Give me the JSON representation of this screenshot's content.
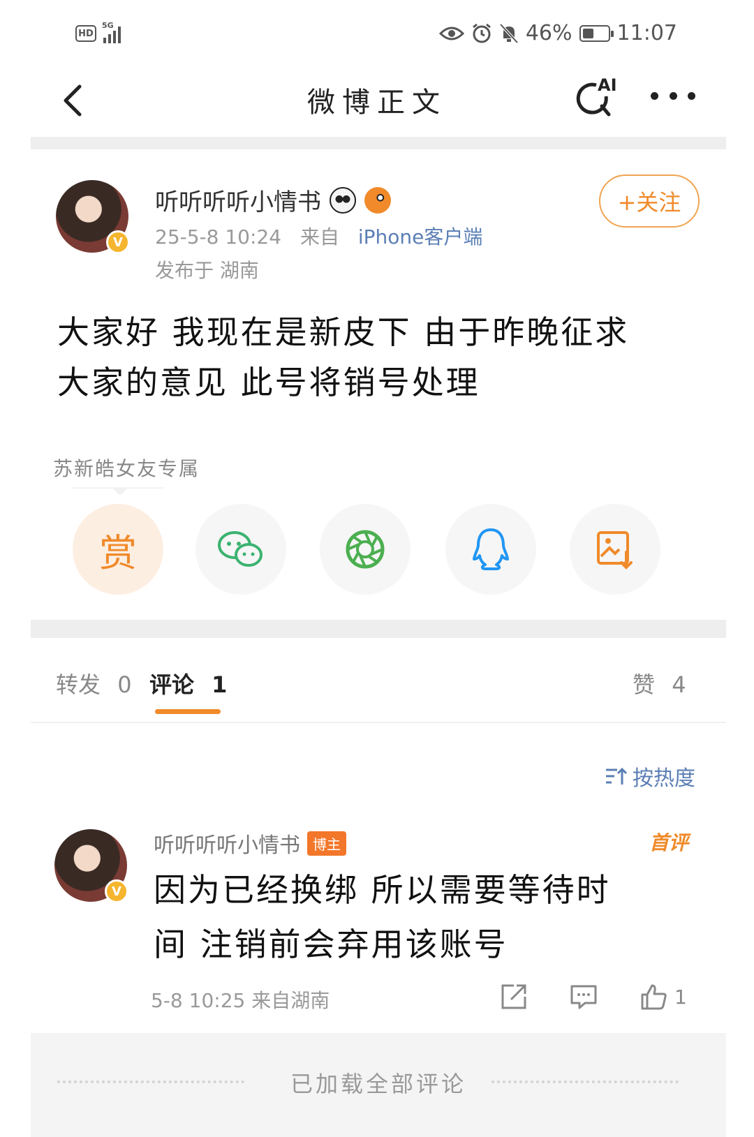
{
  "status_bar": {
    "hd": "HD",
    "network": "5G",
    "battery": "46%",
    "battery_level": 0.46,
    "time": "11:07"
  },
  "nav": {
    "title": "微博正文",
    "ai_label": "AI"
  },
  "post": {
    "author": "听听听听小情书",
    "follow_label": "+关注",
    "datetime": "25-5-8 10:24",
    "from_prefix": "来自",
    "source": "iPhone客户端",
    "location": "发布于 湖南",
    "content_line1": "大家好 我现在是新皮下 由于昨晚征求",
    "content_line2": "大家的意见 此号将销号处理",
    "tag": "苏新皓女友专属"
  },
  "share": {
    "reward_label": "赏"
  },
  "tabs": [
    {
      "label": "转发",
      "count": "0"
    },
    {
      "label": "评论",
      "count": "1"
    },
    {
      "label": "赞",
      "count": "4"
    }
  ],
  "sort_label": "按热度",
  "comment": {
    "author": "听听听听小情书",
    "host_badge": "博主",
    "first_tag": "首评",
    "text_line1": "因为已经换绑 所以需要等待时",
    "text_line2": "间 注销前会弃用该账号",
    "meta": "5-8 10:25 来自湖南",
    "like_count": "1"
  },
  "footer_text": "已加载全部评论",
  "colors": {
    "accent": "#f08a2a",
    "link": "#5b7fb5",
    "wechat": "#3cb371",
    "moments": "#4caf50",
    "qq": "#2196f3"
  }
}
